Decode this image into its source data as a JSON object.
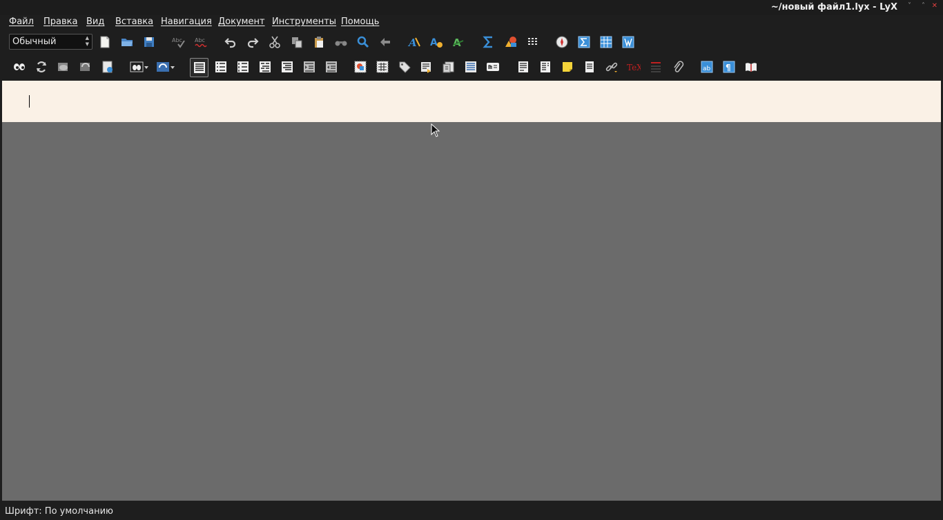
{
  "window": {
    "title": "~/новый файл1.lyx - LyX",
    "controls": {
      "minimize": "˅",
      "maximize": "˄",
      "close": "✕"
    }
  },
  "menu": [
    "Файл",
    "Правка",
    "Вид",
    "Вставка",
    "Навигация",
    "Документ",
    "Инструменты",
    "Помощь"
  ],
  "toolbar": {
    "paragraph_style": "Обычный",
    "spellcheck_label": "Abc",
    "autocorrect_label": "Abc",
    "tex_label": "TeX"
  },
  "colors": {
    "document_background": "#faf1e6",
    "workspace": "#6b6b6b",
    "chrome": "#1e1e1e",
    "accent_blue": "#3a8fd8",
    "accent_red": "#c02020",
    "note_yellow": "#f4d43a"
  },
  "status": {
    "text": "Шрифт: По умолчанию"
  }
}
